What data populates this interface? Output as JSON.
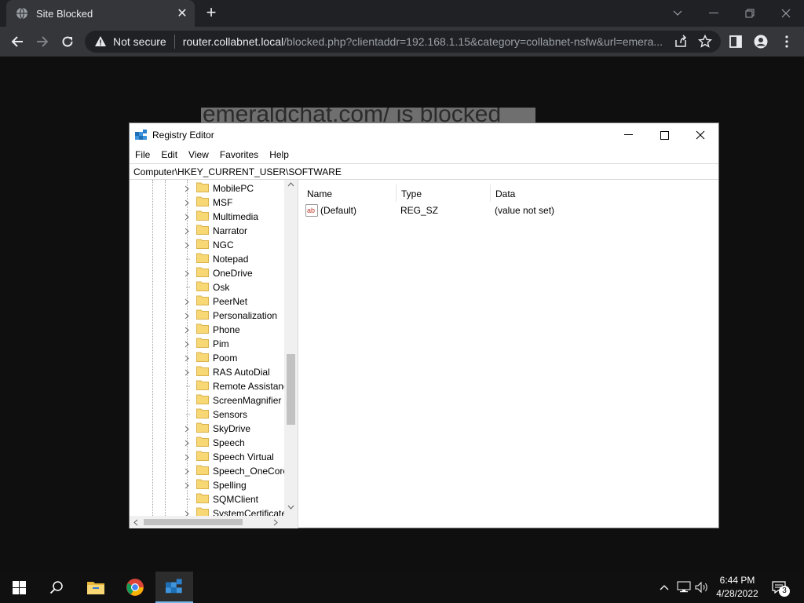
{
  "browser": {
    "tab_title": "Site Blocked",
    "new_tab": "+",
    "not_secure": "Not secure",
    "url_host": "router.collabnet.local",
    "url_path": "/blocked.php?clientaddr=192.168.1.15&category=collabnet-nsfw&url=emera..."
  },
  "page": {
    "blocked_heading": "emeraldchat.com/ is blocked"
  },
  "regedit": {
    "title": "Registry Editor",
    "menu": [
      "File",
      "Edit",
      "View",
      "Favorites",
      "Help"
    ],
    "address": "Computer\\HKEY_CURRENT_USER\\SOFTWARE",
    "tree": [
      {
        "label": "MobilePC",
        "expandable": true
      },
      {
        "label": "MSF",
        "expandable": true
      },
      {
        "label": "Multimedia",
        "expandable": true
      },
      {
        "label": "Narrator",
        "expandable": true
      },
      {
        "label": "NGC",
        "expandable": true
      },
      {
        "label": "Notepad",
        "expandable": false
      },
      {
        "label": "OneDrive",
        "expandable": true
      },
      {
        "label": "Osk",
        "expandable": false
      },
      {
        "label": "PeerNet",
        "expandable": true
      },
      {
        "label": "Personalization",
        "expandable": true
      },
      {
        "label": "Phone",
        "expandable": true
      },
      {
        "label": "Pim",
        "expandable": true
      },
      {
        "label": "Poom",
        "expandable": true
      },
      {
        "label": "RAS AutoDial",
        "expandable": true
      },
      {
        "label": "Remote Assistance",
        "expandable": false
      },
      {
        "label": "ScreenMagnifier",
        "expandable": false
      },
      {
        "label": "Sensors",
        "expandable": false
      },
      {
        "label": "SkyDrive",
        "expandable": true
      },
      {
        "label": "Speech",
        "expandable": true
      },
      {
        "label": "Speech Virtual",
        "expandable": true
      },
      {
        "label": "Speech_OneCore",
        "expandable": true
      },
      {
        "label": "Spelling",
        "expandable": true
      },
      {
        "label": "SQMClient",
        "expandable": false
      },
      {
        "label": "SystemCertificates",
        "expandable": true
      }
    ],
    "columns": {
      "name": "Name",
      "type": "Type",
      "data": "Data"
    },
    "values": [
      {
        "name": "(Default)",
        "type": "REG_SZ",
        "data": "(value not set)"
      }
    ]
  },
  "taskbar": {
    "time": "6:44 PM",
    "date": "4/28/2022",
    "notification_count": "3"
  },
  "colors": {
    "chrome_dark": "#202124",
    "chrome_toolbar": "#35363a",
    "folder_yellow": "#f8d775",
    "taskbar_accent": "#76b9ed"
  },
  "icons": [
    "globe-icon",
    "close-icon",
    "back-icon",
    "forward-icon",
    "reload-icon",
    "warning-icon",
    "share-icon",
    "star-icon",
    "sidepanel-icon",
    "profile-icon",
    "menu-icon",
    "registry-icon",
    "minimize-icon",
    "maximize-icon",
    "folder-icon",
    "chevron-right-icon",
    "windows-icon",
    "search-icon",
    "file-explorer-icon",
    "chrome-icon",
    "chevron-up-icon",
    "network-icon",
    "volume-icon",
    "notification-icon"
  ]
}
